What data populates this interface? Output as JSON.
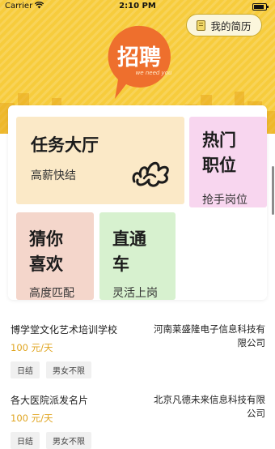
{
  "status_bar": {
    "carrier": "Carrier",
    "time": "2:10 PM"
  },
  "header": {
    "logo_text": "招聘",
    "logo_subtext": "we need you",
    "resume_button_label": "我的简历"
  },
  "cards": {
    "task_hall": {
      "title": "任务大厅",
      "subtitle": "高薪快结"
    },
    "hot_jobs": {
      "title": "热门职位",
      "subtitle": "抢手岗位"
    },
    "guess": {
      "title": "猜你喜欢",
      "subtitle": "高度匹配"
    },
    "direct": {
      "title": "直通车",
      "subtitle": "灵活上岗"
    }
  },
  "jobs": [
    {
      "title": "博学堂文化艺术培训学校",
      "company": "河南莱盛隆电子信息科技有限公司",
      "salary": "100 元/天",
      "tags": [
        "日结",
        "男女不限"
      ]
    },
    {
      "title": "各大医院派发名片",
      "company": "北京凡德未来信息科技有限公司",
      "salary": "100 元/天",
      "tags": [
        "日结",
        "男女不限"
      ]
    }
  ],
  "colors": {
    "hero_yellow": "#f7cc3c",
    "logo_orange": "#ee6f2d",
    "salary_gold": "#e0a520",
    "task_card": "#fbe9c7",
    "hot_card": "#f8d6ef",
    "guess_card": "#f4d6cb",
    "direct_card": "#d7f1cf"
  }
}
